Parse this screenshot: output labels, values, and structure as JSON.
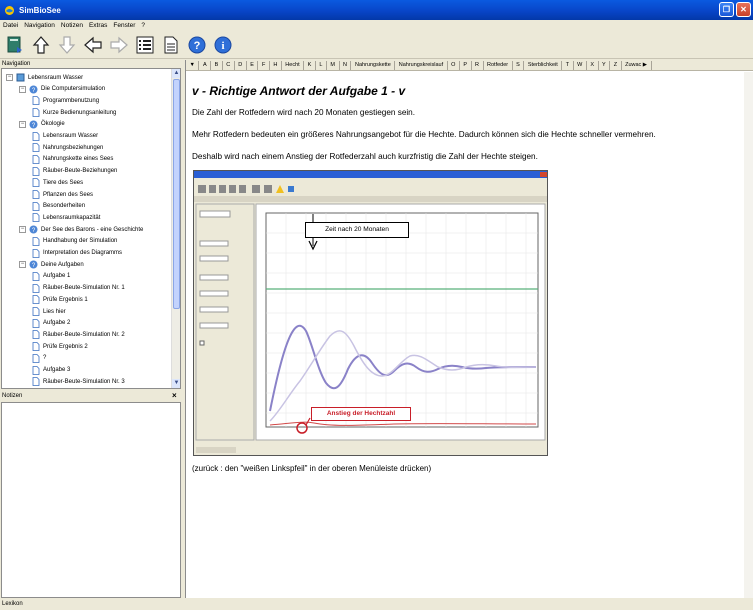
{
  "window": {
    "title": "SimBioSee"
  },
  "menu": [
    "Datei",
    "Navigation",
    "Notizen",
    "Extras",
    "Fenster",
    "?"
  ],
  "toolbar": {
    "icons": [
      "book-icon",
      "arrow-up-icon",
      "arrow-down-icon",
      "arrow-left-icon",
      "arrow-right-icon",
      "list-icon",
      "page-icon",
      "help-icon",
      "info-icon"
    ]
  },
  "navigation": {
    "label": "Navigation",
    "items": [
      {
        "label": "Lebensraum Wasser",
        "level": 0
      },
      {
        "label": "Die Computersimulation",
        "level": 1
      },
      {
        "label": "Programmbenutzung",
        "level": 2
      },
      {
        "label": "Kurze Bedienungsanleitung",
        "level": 2
      },
      {
        "label": "Ökologie",
        "level": 1
      },
      {
        "label": "Lebensraum Wasser",
        "level": 2
      },
      {
        "label": "Nahrungsbeziehungen",
        "level": 2
      },
      {
        "label": "Nahrungskette eines Sees",
        "level": 2
      },
      {
        "label": "Räuber-Beute-Beziehungen",
        "level": 2
      },
      {
        "label": "Tiere des Sees",
        "level": 2
      },
      {
        "label": "Pflanzen des Sees",
        "level": 2
      },
      {
        "label": "Besonderheiten",
        "level": 2
      },
      {
        "label": "Lebensraumkapazität",
        "level": 2
      },
      {
        "label": "Der See des Barons - eine Geschichte",
        "level": 1
      },
      {
        "label": "Handhabung der Simulation",
        "level": 2
      },
      {
        "label": "Interpretation des Diagramms",
        "level": 2
      },
      {
        "label": "Deine Aufgaben",
        "level": 1
      },
      {
        "label": "Aufgabe 1",
        "level": 2
      },
      {
        "label": "Räuber-Beute-Simulation Nr. 1",
        "level": 2
      },
      {
        "label": "Prüfe Ergebnis 1",
        "level": 2
      },
      {
        "label": "Lies hier",
        "level": 2
      },
      {
        "label": "Aufgabe 2",
        "level": 2
      },
      {
        "label": "Räuber-Beute-Simulation Nr. 2",
        "level": 2
      },
      {
        "label": "Prüfe Ergebnis 2",
        "level": 2
      },
      {
        "label": "?",
        "level": 2
      },
      {
        "label": "Aufgabe 3",
        "level": 2
      },
      {
        "label": "Räuber-Beute-Simulation Nr. 3",
        "level": 2
      }
    ]
  },
  "notes": {
    "label": "Notizen",
    "close": "×"
  },
  "status": {
    "label": "Lexikon"
  },
  "index_tabs": [
    "▼",
    "A",
    "B",
    "C",
    "D",
    "E",
    "F",
    "H",
    "Hecht",
    "K",
    "L",
    "M",
    "N",
    "Nahrungskette",
    "Nahrungskreislauf",
    "O",
    "P",
    "R",
    "Rotfeder",
    "S",
    "Sterblichkeit",
    "T",
    "W",
    "X",
    "Y",
    "Z",
    "Zuwac ▶"
  ],
  "page": {
    "title": "v - Richtige Antwort der Aufgabe 1 - v",
    "paragraphs": [
      "Die Zahl der Rotfedern wird nach 20 Monaten gestiegen sein.",
      "Mehr Rotfedern bedeuten ein größeres Nahrungsangebot für die Hechte. Dadurch können sich die Hechte schneller vermehren.",
      "Deshalb wird nach einem Anstieg der Rotfederzahl auch kurzfristig die Zahl der Hechte steigen."
    ],
    "footer": "(zurück : den \"weißen Linkspfeil\" in der oberen Menüleiste drücken)"
  },
  "screenshot": {
    "annotation_time": "Zeit nach 20 Monaten",
    "annotation_rise": "Anstieg der Hechtzahl",
    "colors": {
      "prey_curve": "#8a82c8",
      "predator_curve": "#c8c3e3",
      "capacity_line": "#59b07a",
      "pike_curve": "#d24a4a",
      "annotation_red": "#c81e28"
    }
  }
}
